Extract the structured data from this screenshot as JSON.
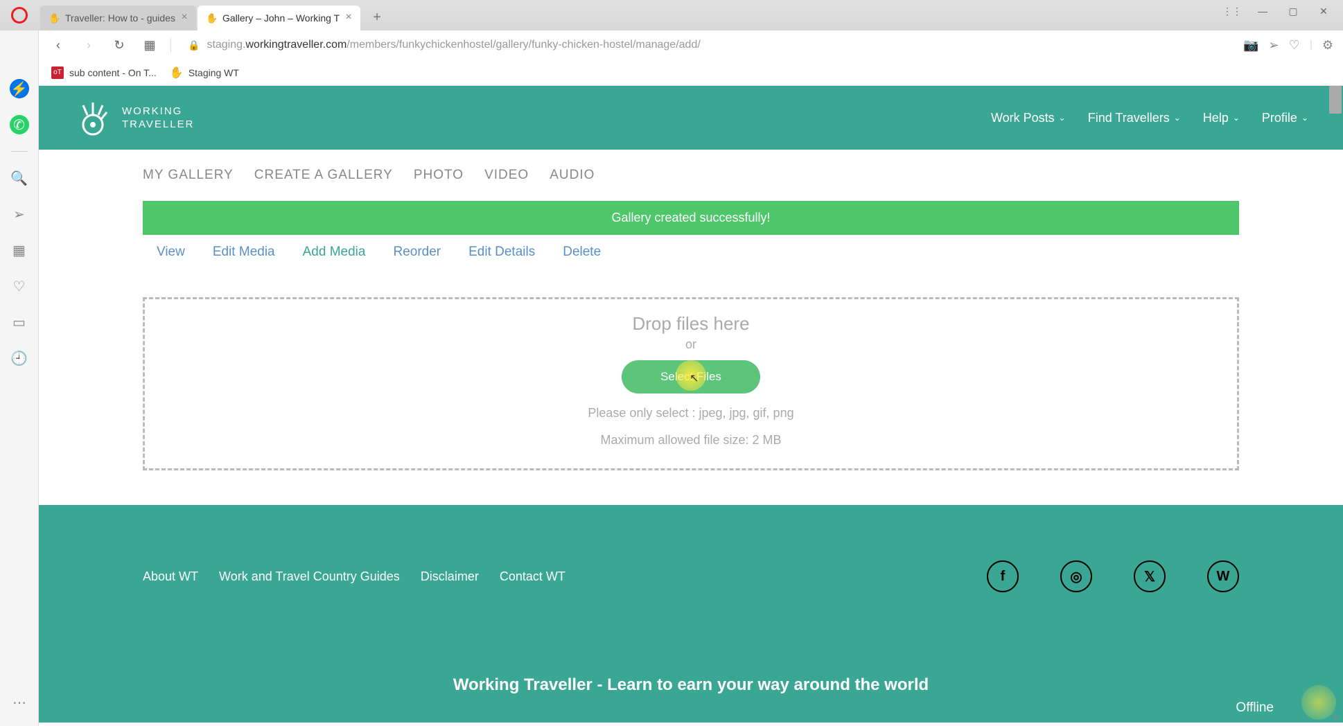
{
  "browser": {
    "tabs": [
      {
        "title": "Traveller: How to - guides",
        "active": false
      },
      {
        "title": "Gallery – John – Working T",
        "active": true
      }
    ],
    "url_prefix": "staging.",
    "url_domain": "workingtraveller.com",
    "url_path": "/members/funkychickenhostel/gallery/funky-chicken-hostel/manage/add/",
    "bookmarks": [
      {
        "label": "sub content - On T...",
        "icon": "ot"
      },
      {
        "label": "Staging WT",
        "icon": "wt"
      }
    ]
  },
  "header": {
    "logo_line1": "WORKING",
    "logo_line2": "TRAVELLER",
    "nav": [
      {
        "label": "Work Posts"
      },
      {
        "label": "Find Travellers"
      },
      {
        "label": "Help"
      },
      {
        "label": "Profile"
      }
    ]
  },
  "sub_nav": [
    "MY GALLERY",
    "CREATE A GALLERY",
    "PHOTO",
    "VIDEO",
    "AUDIO"
  ],
  "alert": "Gallery created successfully!",
  "gallery_tabs": [
    {
      "label": "View",
      "active": false
    },
    {
      "label": "Edit Media",
      "active": false
    },
    {
      "label": "Add Media",
      "active": true
    },
    {
      "label": "Reorder",
      "active": false
    },
    {
      "label": "Edit Details",
      "active": false
    },
    {
      "label": "Delete",
      "active": false
    }
  ],
  "dropzone": {
    "title": "Drop files here",
    "or": "or",
    "button": "Select Files",
    "hint1": "Please only select : jpeg, jpg, gif, png",
    "hint2": "Maximum allowed file size: 2 MB"
  },
  "footer": {
    "links": [
      "About WT",
      "Work and Travel Country Guides",
      "Disclaimer",
      "Contact WT"
    ],
    "tagline": "Working Traveller - Learn to earn your way around the world",
    "offline": "Offline"
  }
}
